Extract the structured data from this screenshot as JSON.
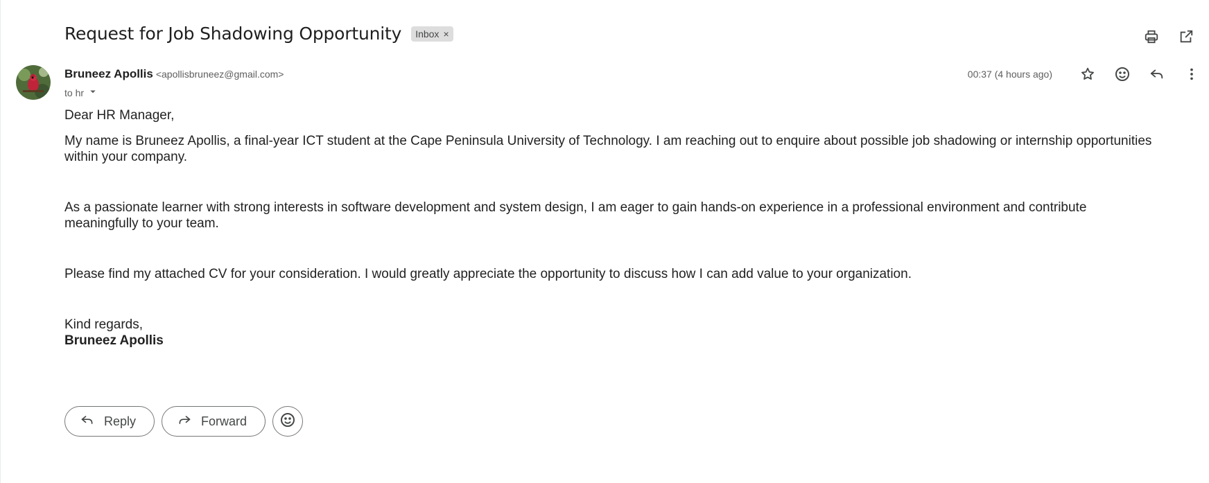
{
  "email": {
    "subject": "Request for Job Shadowing Opportunity",
    "label": "Inbox",
    "label_remove": "×",
    "sender_name": "Bruneez Apollis",
    "sender_email": "<apollisbruneez@gmail.com>",
    "recipient": "to hr",
    "timestamp": "00:37 (4 hours ago)",
    "body": {
      "greeting": "Dear HR Manager,",
      "paragraphs": [
        "My name is Bruneez Apollis, a final-year ICT student at the Cape Peninsula University of Technology. I am reaching out to enquire about possible job shadowing or internship opportunities within your company.",
        "As a passionate learner with strong interests in software development and system design, I am eager to gain hands-on experience in a professional environment and contribute meaningfully to your team.",
        "Please find my attached CV for your consideration. I would greatly appreciate the opportunity to discuss how I can add value to your organization."
      ],
      "closing": "Kind regards,",
      "signature": "Bruneez Apollis"
    }
  },
  "actions": {
    "reply_label": "Reply",
    "forward_label": "Forward"
  },
  "icons": {
    "print": "print-icon",
    "open_new_window": "open-in-new-window-icon",
    "star": "star-icon",
    "emoji": "emoji-icon",
    "reply": "reply-icon",
    "more": "more-vertical-icon",
    "dropdown": "chevron-down-icon",
    "forward": "forward-icon"
  },
  "colors": {
    "label_chip_bg": "#dddddd",
    "text_primary": "#1f1f1f",
    "text_secondary": "#5e5e5e",
    "button_border": "#747775"
  }
}
